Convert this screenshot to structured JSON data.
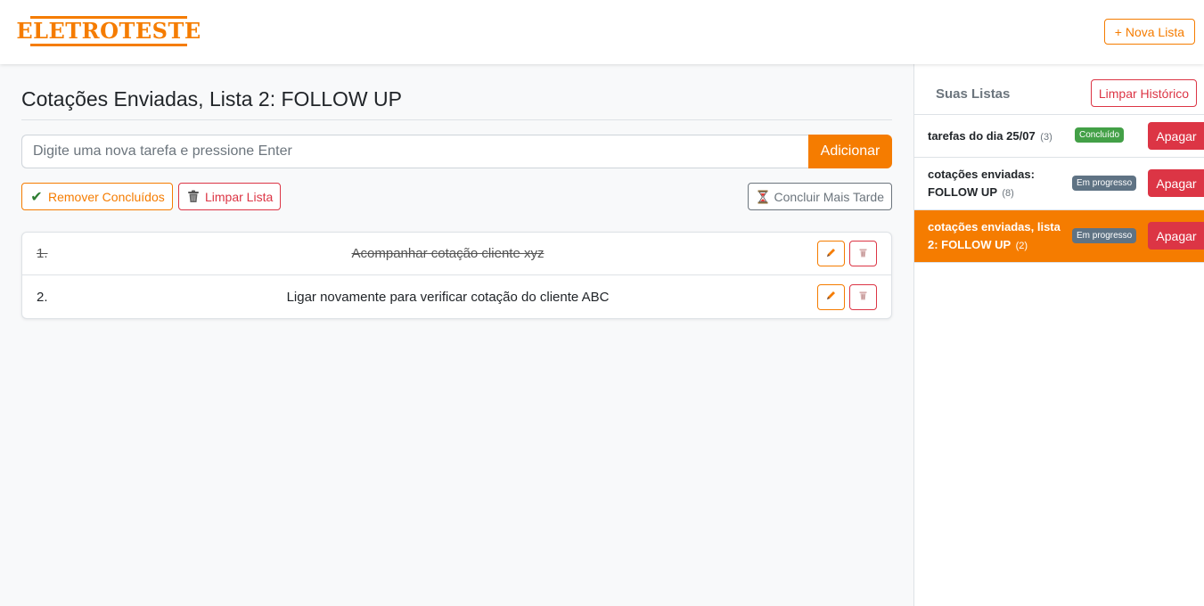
{
  "header": {
    "logo_text": "ELETROTESTE",
    "new_list_label": "+ Nova Lista"
  },
  "main": {
    "title": "Cotações Enviadas, Lista 2: FOLLOW UP",
    "input_placeholder": "Digite uma nova tarefa e pressione Enter",
    "add_label": "Adicionar",
    "remove_done_label": "Remover Concluídos",
    "clear_list_label": "Limpar Lista",
    "finish_later_label": "Concluir Mais Tarde",
    "tasks": [
      {
        "num": "1.",
        "text": "Acompanhar cotação cliente xyz",
        "done": true
      },
      {
        "num": "2.",
        "text": "Ligar novamente para verificar cotação do cliente ABC",
        "done": false
      }
    ]
  },
  "sidebar": {
    "title": "Suas Listas",
    "clear_history_label": "Limpar Histórico",
    "delete_label": "Apagar",
    "lists": [
      {
        "name": "tarefas do dia 25/07",
        "count": "(3)",
        "status": "Concluído",
        "active": false
      },
      {
        "name_line1": "cotações enviadas:",
        "name_line2": "FOLLOW UP",
        "count": "(8)",
        "status": "Em progresso",
        "active": false
      },
      {
        "name_line1": "cotações enviadas, lista",
        "name_line2": "2: FOLLOW UP",
        "count": "(2)",
        "status": "Em progresso",
        "active": true
      }
    ]
  },
  "colors": {
    "accent": "#f57c00",
    "danger": "#dc3545",
    "success": "#43a047",
    "secondary": "#5f7384"
  },
  "icons": {
    "check": "check-icon",
    "trash": "trash-icon",
    "hourglass": "hourglass-icon",
    "pencil": "pencil-icon"
  }
}
